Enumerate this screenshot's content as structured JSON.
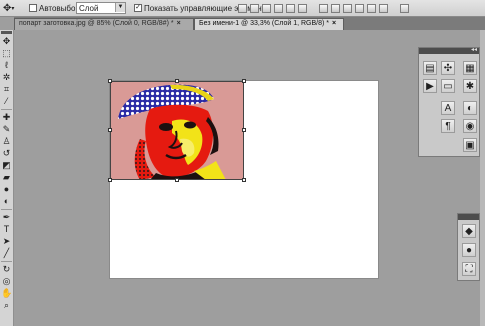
{
  "options_bar": {
    "tool_icon": "move-tool-icon",
    "auto_select_label": "Автовыбор:",
    "auto_select_checked": false,
    "auto_select_value": "Слой",
    "show_controls_label": "Показать управляющие элементы",
    "show_controls_checked": true
  },
  "tabs": [
    {
      "label": "попарт заготовка.jpg @ 85% (Слой 0, RGB/8#) *",
      "close": "×",
      "active": false
    },
    {
      "label": "Без имени-1 @ 33,3% (Слой 1, RGB/8) *",
      "close": "×",
      "active": true
    }
  ],
  "toolbox_icons": [
    "move-icon",
    "marquee-icon",
    "lasso-icon",
    "magic-wand-icon",
    "crop-icon",
    "eyedropper-icon",
    "healing-brush-icon",
    "brush-icon",
    "clone-stamp-icon",
    "history-brush-icon",
    "eraser-icon",
    "gradient-icon",
    "blur-icon",
    "dodge-icon",
    "pen-icon",
    "type-icon",
    "path-selection-icon",
    "shape-icon",
    "3d-rotate-icon",
    "3d-orbit-icon",
    "hand-icon",
    "zoom-icon"
  ],
  "panels": {
    "group1_icons": [
      "histogram-icon",
      "navigator-icon",
      "info-icon",
      "color-icon",
      "swatches-icon",
      "styles-icon",
      "character-icon",
      "paragraph-icon",
      "adjustments-icon",
      "masks-icon"
    ],
    "group2_icons": [
      "layers-icon",
      "channels-icon",
      "paths-icon"
    ]
  },
  "colors": {
    "workspace": "#9e9e9e",
    "canvas": "#ffffff",
    "photo_bg": "#d99a96",
    "photo_red": "#e51a10",
    "photo_yellow": "#f2e318",
    "photo_blue": "#2a2aa8"
  }
}
